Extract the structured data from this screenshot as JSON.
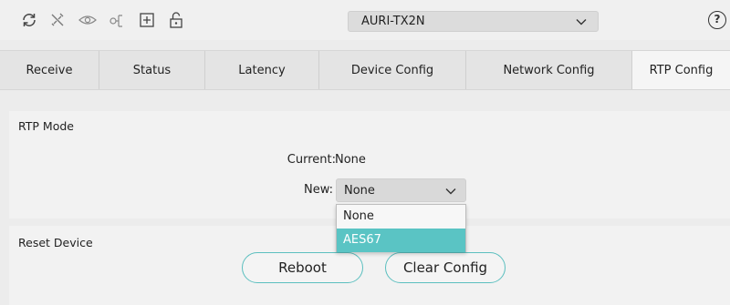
{
  "toolbar": {
    "icons": [
      "refresh-icon",
      "disconnect-icon",
      "eye-icon",
      "network-icon",
      "add-icon",
      "unlock-icon"
    ],
    "device_value": "AURI-TX2N",
    "help_label": "?"
  },
  "tabs": [
    {
      "label": "Receive"
    },
    {
      "label": "Status"
    },
    {
      "label": "Latency"
    },
    {
      "label": "Device Config"
    },
    {
      "label": "Network Config"
    },
    {
      "label": "RTP Config"
    }
  ],
  "rtp_mode": {
    "title": "RTP Mode",
    "current_label": "Current:",
    "current_value": "None",
    "new_label": "New:",
    "new_value": "None",
    "options": [
      "None",
      "AES67"
    ],
    "highlighted_option": "AES67"
  },
  "reset_device": {
    "title": "Reset Device",
    "reboot_label": "Reboot",
    "clear_config_label": "Clear Config"
  },
  "colors": {
    "accent": "#5ac4c4",
    "button_border": "#5bbfbf"
  }
}
